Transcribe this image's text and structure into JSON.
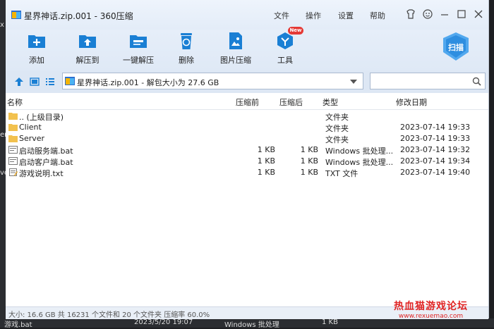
{
  "window": {
    "title": "星界神话.zip.001 - 360压缩"
  },
  "menu": [
    "文件",
    "操作",
    "设置",
    "帮助"
  ],
  "toolbar": {
    "items": [
      "添加",
      "解压到",
      "一键解压",
      "删除",
      "图片压缩",
      "工具"
    ],
    "new_badge": "New",
    "scan_label": "扫描"
  },
  "address": {
    "path": "星界神话.zip.001 - 解包大小为 27.6 GB"
  },
  "search": {
    "placeholder": ""
  },
  "columns": {
    "name": "名称",
    "compressed": "压缩前",
    "original": "压缩后",
    "type": "类型",
    "modified": "修改日期"
  },
  "files": [
    {
      "name": ".. (上级目录)",
      "icon": "folder-icon",
      "compressed": "",
      "original": "",
      "type": "文件夹",
      "modified": ""
    },
    {
      "name": "Client",
      "icon": "folder-icon",
      "compressed": "",
      "original": "",
      "type": "文件夹",
      "modified": "2023-07-14 19:33"
    },
    {
      "name": "Server",
      "icon": "folder-icon",
      "compressed": "",
      "original": "",
      "type": "文件夹",
      "modified": "2023-07-14 19:33"
    },
    {
      "name": "启动服务端.bat",
      "icon": "bat-file-icon",
      "compressed": "1 KB",
      "original": "1 KB",
      "type": "Windows 批处理...",
      "modified": "2023-07-14 19:32"
    },
    {
      "name": "启动客户端.bat",
      "icon": "bat-file-icon",
      "compressed": "1 KB",
      "original": "1 KB",
      "type": "Windows 批处理...",
      "modified": "2023-07-14 19:34"
    },
    {
      "name": "游戏说明.txt",
      "icon": "txt-file-icon",
      "compressed": "1 KB",
      "original": "1 KB",
      "type": "TXT 文件",
      "modified": "2023-07-14 19:40"
    }
  ],
  "status": {
    "text": "大小: 16.6 GB 共 16231 个文件和 20 个文件夹 压缩率 60.0%"
  },
  "watermark": {
    "line1": "热血猫游戏论坛",
    "line2": "www.rexuemao.com"
  },
  "background": {
    "left_fragments": [
      "x",
      "ent",
      "ve"
    ],
    "bottom_row": {
      "name": "游戏.bat",
      "date": "2023/5/20 19:07",
      "type": "Windows 批处理",
      "size": "1 KB"
    }
  },
  "colors": {
    "accent": "#1a7fd4",
    "toolbar_bg": "#e3ecf8",
    "watermark": "#e02424",
    "folder": "#f2c14e"
  }
}
